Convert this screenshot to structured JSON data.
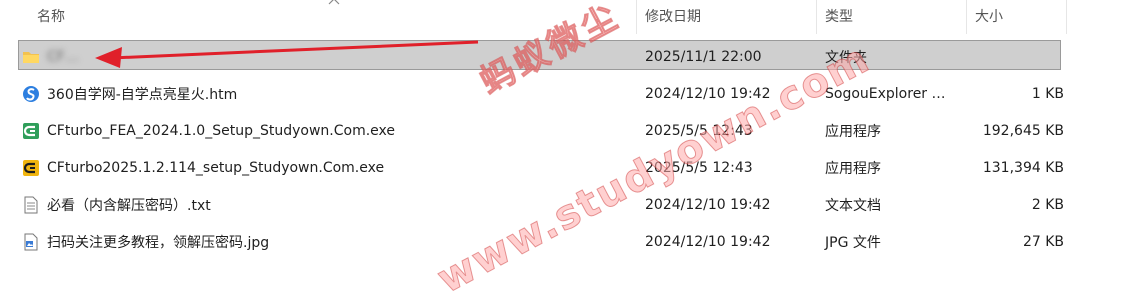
{
  "columns": {
    "name": "名称",
    "date": "修改日期",
    "type": "类型",
    "size": "大小"
  },
  "files": [
    {
      "name": "CF…",
      "date": "2025/11/1 22:00",
      "type": "文件夹",
      "size": "",
      "icon": "folder-icon",
      "selected": true
    },
    {
      "name": "360自学网-自学点亮星火.htm",
      "date": "2024/12/10 19:42",
      "type": "SogouExplorer …",
      "size": "1 KB",
      "icon": "sogou-explorer-icon"
    },
    {
      "name": "CFturbo_FEA_2024.1.0_Setup_Studyown.Com.exe",
      "date": "2025/5/5 12:43",
      "type": "应用程序",
      "size": "192,645 KB",
      "icon": "cfturbo-green-icon"
    },
    {
      "name": "CFturbo2025.1.2.114_setup_Studyown.Com.exe",
      "date": "2025/5/5 12:43",
      "type": "应用程序",
      "size": "131,394 KB",
      "icon": "cfturbo-yellow-icon"
    },
    {
      "name": "必看（内含解压密码）.txt",
      "date": "2024/12/10 19:42",
      "type": "文本文档",
      "size": "2 KB",
      "icon": "text-file-icon"
    },
    {
      "name": "扫码关注更多教程，领解压密码.jpg",
      "date": "2024/12/10 19:42",
      "type": "JPG 文件",
      "size": "27 KB",
      "icon": "image-file-icon"
    }
  ],
  "watermarks": {
    "chinese": "蚂蚁微尘",
    "url": "www.studyown.com"
  },
  "colors": {
    "selection": "#cfcfcf",
    "arrow": "#e0202a",
    "watermark": "#ff9a9a"
  }
}
